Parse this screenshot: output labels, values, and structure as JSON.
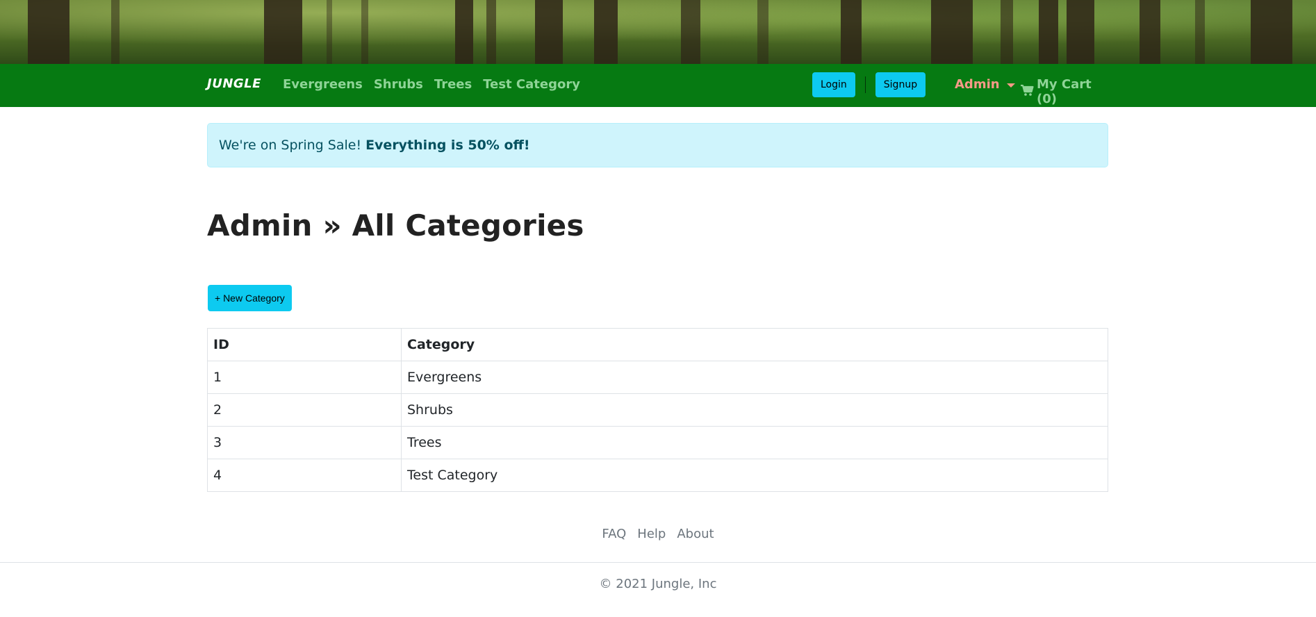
{
  "navbar": {
    "brand": "JUNGLE",
    "links": [
      "Evergreens",
      "Shrubs",
      "Trees",
      "Test Category"
    ],
    "login_label": "Login",
    "signup_label": "Signup",
    "admin_label": "Admin",
    "cart_label": "My Cart (0)"
  },
  "alert": {
    "prefix": "We're on Spring Sale!",
    "emphasis": "Everything is 50% off!"
  },
  "page": {
    "title": "Admin » All Categories",
    "new_button_label": "+ New Category"
  },
  "table": {
    "headers": [
      "ID",
      "Category"
    ],
    "rows": [
      [
        "1",
        "Evergreens"
      ],
      [
        "2",
        "Shrubs"
      ],
      [
        "3",
        "Trees"
      ],
      [
        "4",
        "Test Category"
      ]
    ]
  },
  "footer": {
    "links": [
      "FAQ",
      "Help",
      "About"
    ],
    "copyright": "© 2021 Jungle, Inc"
  },
  "colors": {
    "navbar": "#067a12",
    "accent_button": "#0dcaf0",
    "admin_link": "#f79a88",
    "alert_bg": "#cff4fc"
  },
  "icons": [
    "shopping-cart-icon",
    "caret-down-icon"
  ]
}
